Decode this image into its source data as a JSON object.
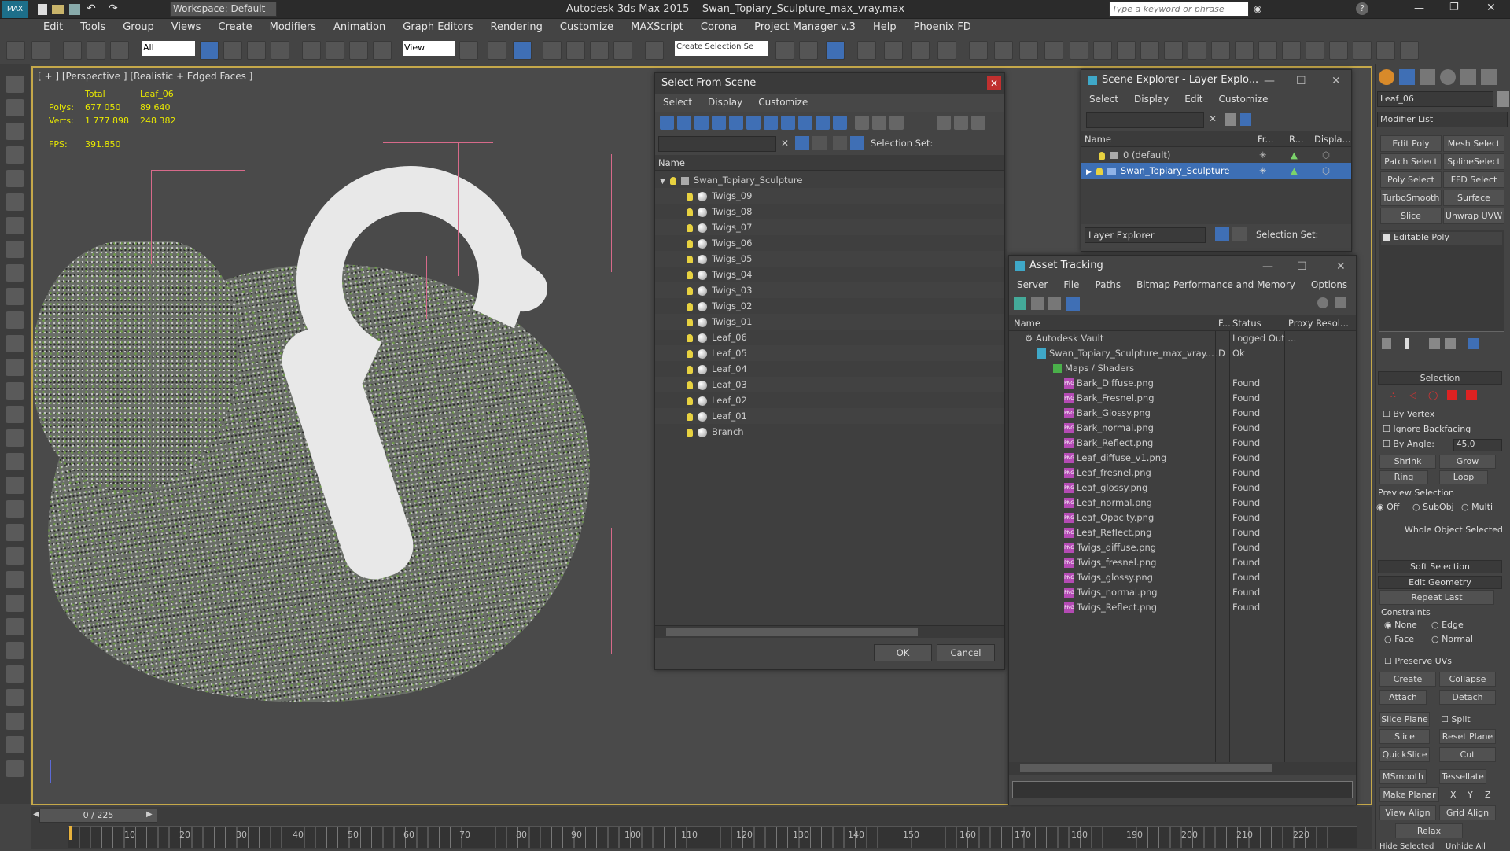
{
  "title": {
    "app": "Autodesk 3ds Max  2015",
    "file": "Swan_Topiary_Sculpture_max_vray.max",
    "workspace": "Workspace: Default",
    "search_placeholder": "Type a keyword or phrase"
  },
  "menu": [
    "Edit",
    "Tools",
    "Group",
    "Views",
    "Create",
    "Modifiers",
    "Animation",
    "Graph Editors",
    "Rendering",
    "Customize",
    "MAXScript",
    "Corona",
    "Project Manager v.3",
    "Help",
    "Phoenix FD"
  ],
  "toolbar": {
    "filter": "All",
    "refcoord": "View",
    "selset": "Create Selection Se"
  },
  "viewport": {
    "label": "[ + ] [Perspective ] [Realistic + Edged Faces ]",
    "stats": {
      "h_total": "Total",
      "h_obj": "Leaf_06",
      "polys_label": "Polys:",
      "polys_total": "677 050",
      "polys_obj": "89 640",
      "verts_label": "Verts:",
      "verts_total": "1 777 898",
      "verts_obj": "248 382",
      "fps_label": "FPS:",
      "fps": "391.850"
    }
  },
  "select_scene": {
    "title": "Select From Scene",
    "menu": [
      "Select",
      "Display",
      "Customize"
    ],
    "selection_set": "Selection Set:",
    "col_name": "Name",
    "root": "Swan_Topiary_Sculpture",
    "items": [
      "Twigs_09",
      "Twigs_08",
      "Twigs_07",
      "Twigs_06",
      "Twigs_05",
      "Twigs_04",
      "Twigs_03",
      "Twigs_02",
      "Twigs_01",
      "Leaf_06",
      "Leaf_05",
      "Leaf_04",
      "Leaf_03",
      "Leaf_02",
      "Leaf_01",
      "Branch"
    ],
    "ok": "OK",
    "cancel": "Cancel"
  },
  "scene_explorer": {
    "title": "Scene Explorer - Layer Explo...",
    "menu": [
      "Select",
      "Display",
      "Edit",
      "Customize"
    ],
    "col_name": "Name",
    "col_fr": "Fr...",
    "col_r": "R...",
    "col_disp": "Displa...",
    "layers": [
      "0 (default)",
      "Swan_Topiary_Sculpture"
    ],
    "footer_mode": "Layer Explorer",
    "selection_set": "Selection Set:"
  },
  "asset_tracking": {
    "title": "Asset Tracking",
    "menu": [
      "Server",
      "File",
      "Paths",
      "Bitmap Performance and Memory",
      "Options"
    ],
    "cols": {
      "name": "Name",
      "f": "F...",
      "status": "Status",
      "proxy": "Proxy Resol..."
    },
    "vault": {
      "name": "Autodesk Vault",
      "status": "Logged Out ..."
    },
    "file": {
      "name": "Swan_Topiary_Sculpture_max_vray....",
      "f": "D",
      "status": "Ok"
    },
    "maps": "Maps / Shaders",
    "assets": [
      {
        "name": "Bark_Diffuse.png",
        "status": "Found"
      },
      {
        "name": "Bark_Fresnel.png",
        "status": "Found"
      },
      {
        "name": "Bark_Glossy.png",
        "status": "Found"
      },
      {
        "name": "Bark_normal.png",
        "status": "Found"
      },
      {
        "name": "Bark_Reflect.png",
        "status": "Found"
      },
      {
        "name": "Leaf_diffuse_v1.png",
        "status": "Found"
      },
      {
        "name": "Leaf_fresnel.png",
        "status": "Found"
      },
      {
        "name": "Leaf_glossy.png",
        "status": "Found"
      },
      {
        "name": "Leaf_normal.png",
        "status": "Found"
      },
      {
        "name": "Leaf_Opacity.png",
        "status": "Found"
      },
      {
        "name": "Leaf_Reflect.png",
        "status": "Found"
      },
      {
        "name": "Twigs_diffuse.png",
        "status": "Found"
      },
      {
        "name": "Twigs_fresnel.png",
        "status": "Found"
      },
      {
        "name": "Twigs_glossy.png",
        "status": "Found"
      },
      {
        "name": "Twigs_normal.png",
        "status": "Found"
      },
      {
        "name": "Twigs_Reflect.png",
        "status": "Found"
      }
    ],
    "png_tag": "PNG"
  },
  "command_panel": {
    "object_name": "Leaf_06",
    "modifier_list": "Modifier List",
    "mod_buttons": [
      "Edit Poly",
      "Mesh Select",
      "Patch Select",
      "SplineSelect",
      "Poly Select",
      "FFD Select",
      "TurboSmooth",
      "Surface Select",
      "Slice",
      "Unwrap UVW"
    ],
    "stack_item": "Editable Poly",
    "selection": {
      "title": "Selection",
      "by_vertex": "By Vertex",
      "ignore_backfacing": "Ignore Backfacing",
      "by_angle": "By Angle:",
      "angle": "45.0",
      "shrink": "Shrink",
      "grow": "Grow",
      "ring": "Ring",
      "loop": "Loop",
      "preview": "Preview Selection",
      "off": "Off",
      "subobj": "SubObj",
      "multi": "Multi",
      "whole": "Whole Object Selected"
    },
    "soft_selection": "Soft Selection",
    "edit_geometry": "Edit Geometry",
    "repeat_last": "Repeat Last",
    "constraints": {
      "title": "Constraints",
      "none": "None",
      "edge": "Edge",
      "face": "Face",
      "normal": "Normal"
    },
    "preserve_uvs": "Preserve UVs",
    "create": "Create",
    "collapse": "Collapse",
    "attach": "Attach",
    "detach": "Detach",
    "slice_plane": "Slice Plane",
    "split": "Split",
    "slice": "Slice",
    "reset_plane": "Reset Plane",
    "quickslice": "QuickSlice",
    "cut": "Cut",
    "msmooth": "MSmooth",
    "tessellate": "Tessellate",
    "make_planar": "Make Planar",
    "x": "X",
    "y": "Y",
    "z": "Z",
    "view_align": "View Align",
    "grid_align": "Grid Align",
    "relax": "Relax",
    "hide_selected": "Hide Selected",
    "unhide_all": "Unhide All"
  },
  "timeline": {
    "frame": "0 / 225",
    "ticks": [
      "10",
      "20",
      "30",
      "40",
      "50",
      "60",
      "70",
      "80",
      "90",
      "100",
      "110",
      "120",
      "130",
      "140",
      "150",
      "160",
      "170",
      "180",
      "190",
      "200",
      "210",
      "220"
    ]
  },
  "colors": {
    "accent": "#4d7cc9",
    "viewport_border": "#c5a84a",
    "stats": "#e8e800"
  }
}
